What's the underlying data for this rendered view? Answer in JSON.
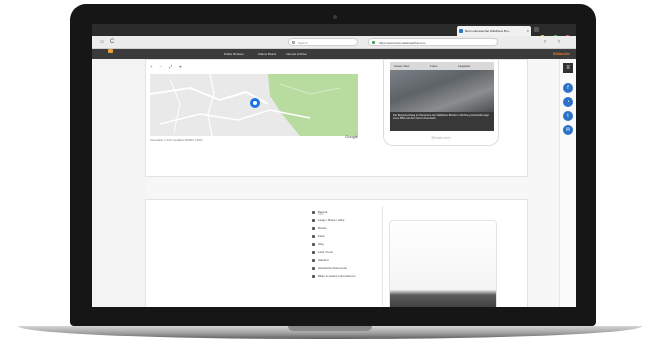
{
  "browser": {
    "tab_title": "Bermudianwachat Waldhaus Bru...",
    "url": "https://www.bermudianwachat.com",
    "search_placeholder": "Search",
    "close_glyph": "×",
    "nav": {
      "back": "‹",
      "forward": "›",
      "reload": "C",
      "home": "⌂"
    }
  },
  "bookmarks": {
    "items": [
      "Public libraries",
      "Claims Board",
      "Internet Archive"
    ],
    "logo": "Bildarchiv"
  },
  "map": {
    "toolbar": [
      "+",
      "−",
      "⤢",
      "⌖"
    ],
    "footer": "Kartendaten © 2017 GeoBasis-DE/BKG ©2009",
    "google": "Google"
  },
  "photo_card": {
    "tabs": [
      "Street View",
      "Fotos",
      "Lageplan"
    ],
    "caption": "Der Bergrutschweg im Panorama der Waldhaus Brücke in Richtung Hochwald zeigt einen Blick auf den Fluss Ulmenbach.",
    "logo": "Bildarchiv"
  },
  "info": {
    "rows": [
      {
        "text": "Bauzeit",
        "sub": "1908"
      },
      {
        "text": "Länge / Breite / Höhe",
        "sub": ""
      },
      {
        "text": "Brücke",
        "sub": ""
      },
      {
        "text": "Fluss",
        "sub": ""
      },
      {
        "text": "Weg",
        "sub": ""
      },
      {
        "text": "Land / Kreis",
        "sub": ""
      },
      {
        "text": "Standort",
        "sub": ""
      },
      {
        "text": "Historische Dokumente",
        "sub": ""
      },
      {
        "text": "Bilder & weitere Informationen",
        "sub": ""
      }
    ]
  },
  "sidebar": {
    "menu_glyph": "≡",
    "buttons": [
      "f",
      "◔",
      "t",
      "✉"
    ]
  },
  "colors": {
    "accent_blue": "#2b72c8",
    "logo_orange": "#e07a2e",
    "map_park": "#b8dca0",
    "marker": "#1a73e8"
  }
}
